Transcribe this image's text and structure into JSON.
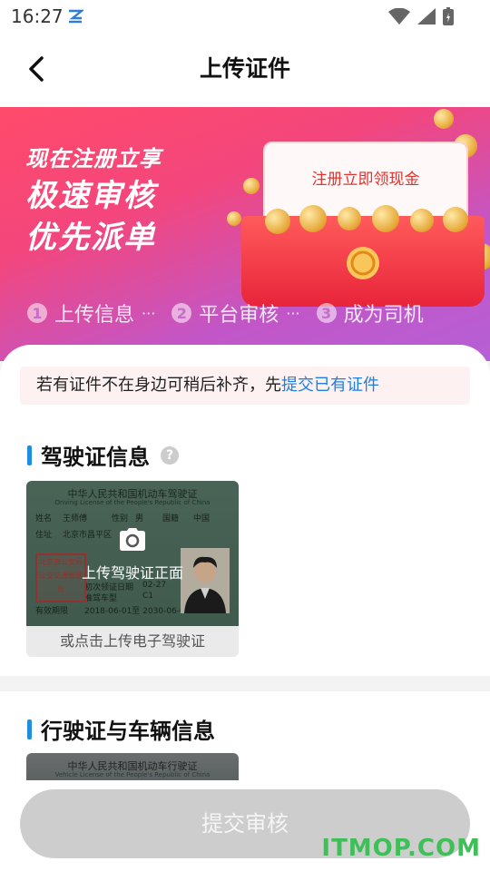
{
  "status_bar": {
    "time": "16:27"
  },
  "header": {
    "title": "上传证件"
  },
  "banner": {
    "line1": "现在注册立享",
    "line2": "极速审核",
    "line3": "优先派单",
    "envelope_text": "注册立即领现金"
  },
  "steps": [
    {
      "num": "1",
      "label": "上传信息",
      "dots": "···"
    },
    {
      "num": "2",
      "label": "平台审核",
      "dots": "···"
    },
    {
      "num": "3",
      "label": "成为司机",
      "dots": ""
    }
  ],
  "notice": {
    "text": "若有证件不在身边可稍后补齐，先",
    "link": "提交已有证件"
  },
  "driver_license": {
    "section_title": "驾驶证信息",
    "help": "?",
    "card": {
      "title": "中华人民共和国机动车驾驶证",
      "subtitle": "Driving License of the People's Republic of China",
      "name_label": "姓名",
      "name": "王师傅",
      "sex_label": "性别",
      "sex": "男",
      "nationality_label": "国籍",
      "nationality": "中国",
      "address_label": "住址",
      "address": "北京市昌平区",
      "date_label": "初次领证日期",
      "date": "02-27",
      "class_label": "准驾车型",
      "class": "C1",
      "valid_label": "有效期限",
      "valid": "2018-06-01至 2030-06-01",
      "stamp": "北京市公安局公安交通管理局"
    },
    "upload_label": "上传驾驶证正面",
    "alt_upload": "或点击上传电子驾驶证"
  },
  "vehicle_license": {
    "section_title": "行驶证与车辆信息",
    "card_title": "中华人民共和国机动车行驶证",
    "card_subtitle": "Vehicle License of the People's Republic of China"
  },
  "submit_label": "提交审核",
  "watermark": "ITMOP.COM"
}
